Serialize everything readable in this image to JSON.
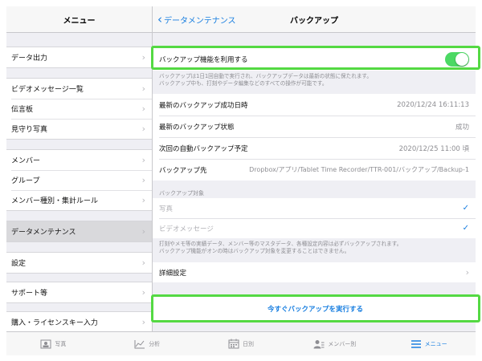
{
  "sidebar": {
    "title": "メニュー",
    "groups": [
      [
        {
          "label": "データ出力"
        }
      ],
      [
        {
          "label": "ビデオメッセージ一覧"
        },
        {
          "label": "伝言板"
        },
        {
          "label": "見守り写真"
        }
      ],
      [
        {
          "label": "メンバー"
        },
        {
          "label": "グループ"
        },
        {
          "label": "メンバー種別・集計ルール"
        }
      ],
      [
        {
          "label": "データメンテナンス",
          "selected": true
        }
      ],
      [
        {
          "label": "設定"
        }
      ],
      [
        {
          "label": "サポート等"
        }
      ],
      [
        {
          "label": "購入・ライセンスキー入力"
        }
      ]
    ]
  },
  "content": {
    "back_label": "データメンテナンス",
    "title": "バックアップ",
    "toggle_label": "バックアップ機能を利用する",
    "toggle_on": true,
    "toggle_note_1": "バックアップは1日1回自動で実行され、バックアップデータは最新の状態に保たれます。",
    "toggle_note_2": "バックアップ中も、打刻やデータ編集などのすべての操作が可能です。",
    "last_success_label": "最新のバックアップ成功日時",
    "last_success_value": "2020/12/24 16:11:13",
    "last_status_label": "最新のバックアップ状態",
    "last_status_value": "成功",
    "next_auto_label": "次回の自動バックアップ予定",
    "next_auto_value": "2020/12/25 11:00 頃",
    "dest_label": "バックアップ先",
    "dest_value": "Dropbox/アプリ/Tablet Time Recorder/TTR-001/バックアップ/Backup-1",
    "targets_header": "バックアップ対象",
    "target_photo": "写真",
    "target_video": "ビデオメッセージ",
    "targets_note_1": "打刻やメモ等の実績データ、メンバー等のマスタデータ、各種設定内容は必ずバックアップされます。",
    "targets_note_2": "バックアップ機能がオンの時はバックアップ対象を変更することはできません。",
    "detail_label": "詳細設定",
    "run_button": "今すぐバックアップを実行する"
  },
  "tabbar": {
    "photo": "写真",
    "analysis": "分析",
    "daily": "日別",
    "member": "メンバー別",
    "menu": "メニュー"
  },
  "colors": {
    "accent": "#1a7fe0",
    "toggle_on": "#4cd964",
    "highlight": "#54d943"
  }
}
